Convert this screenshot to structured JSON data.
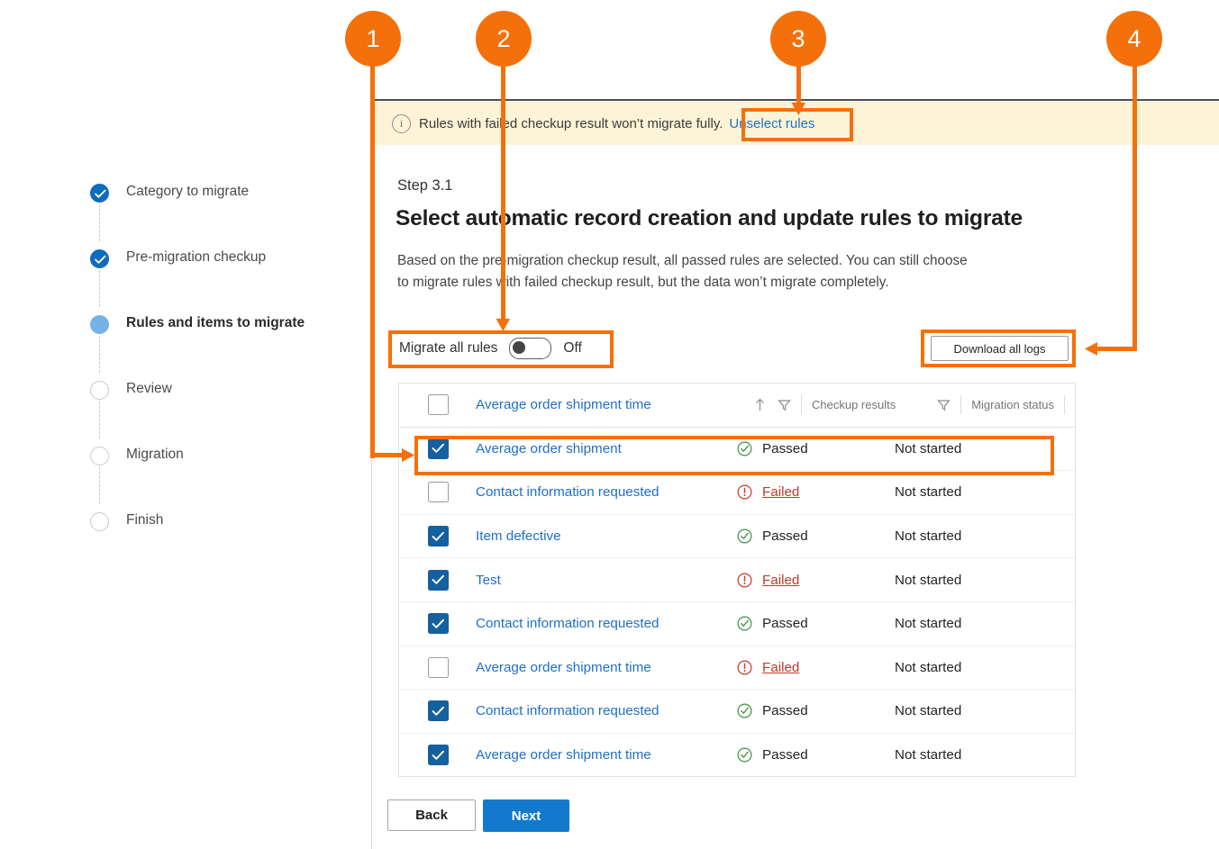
{
  "sidebar": {
    "steps": [
      {
        "label": "Category to migrate",
        "state": "done"
      },
      {
        "label": "Pre-migration checkup",
        "state": "done"
      },
      {
        "label": "Rules and items to migrate",
        "state": "current"
      },
      {
        "label": "Review",
        "state": "todo"
      },
      {
        "label": "Migration",
        "state": "todo"
      },
      {
        "label": "Finish",
        "state": "todo"
      }
    ]
  },
  "info_bar": {
    "icon": "info-circle-icon",
    "message": "Rules with failed checkup result won’t migrate fully.",
    "link_label": "Unselect rules"
  },
  "page": {
    "eyebrow": "Step 3.1",
    "title": "Select automatic record creation and update rules to migrate",
    "description": "Based on the pre-migration checkup result, all passed rules are selected. You can still choose to migrate rules with failed checkup result, but the data won’t migrate completely."
  },
  "controls": {
    "toggle_label": "Migrate all rules",
    "toggle_state": "Off",
    "toggle_on": false,
    "download_logs_label": "Download all logs"
  },
  "table": {
    "header": {
      "name": "Average order shipment time",
      "sort_icon": "sort-ascending-icon",
      "name_filter_icon": "filter-icon",
      "checkup_results": "Checkup results",
      "checkup_filter_icon": "filter-icon",
      "migration_status": "Migration status"
    },
    "rows": [
      {
        "checked": true,
        "name": "Average order shipment",
        "result": "Passed",
        "result_state": "passed",
        "status": "Not started"
      },
      {
        "checked": false,
        "name": "Contact information requested",
        "result": "Failed",
        "result_state": "failed",
        "status": "Not started"
      },
      {
        "checked": true,
        "name": "Item defective",
        "result": "Passed",
        "result_state": "passed",
        "status": "Not started"
      },
      {
        "checked": true,
        "name": "Test",
        "result": "Failed",
        "result_state": "failed",
        "status": "Not started"
      },
      {
        "checked": true,
        "name": "Contact information requested",
        "result": "Passed",
        "result_state": "passed",
        "status": "Not started"
      },
      {
        "checked": false,
        "name": "Average order shipment time",
        "result": "Failed",
        "result_state": "failed",
        "status": "Not started"
      },
      {
        "checked": true,
        "name": "Contact information requested",
        "result": "Passed",
        "result_state": "passed",
        "status": "Not started"
      },
      {
        "checked": true,
        "name": "Average order shipment time",
        "result": "Passed",
        "result_state": "passed",
        "status": "Not started"
      }
    ]
  },
  "footer": {
    "back_label": "Back",
    "next_label": "Next"
  },
  "callouts": {
    "accent_color": "#f4700a",
    "markers": [
      {
        "number": "1",
        "target": "selected-rule-row"
      },
      {
        "number": "2",
        "target": "migrate-all-rules-toggle"
      },
      {
        "number": "3",
        "target": "unselect-rules-link"
      },
      {
        "number": "4",
        "target": "download-all-logs-button"
      }
    ]
  },
  "colors": {
    "accent": "#f4700a",
    "link": "#1f6fc4",
    "primary_button": "#1279cd",
    "passed": "#3f8f43",
    "failed": "#c0392b",
    "info_bar_bg": "#fdf3d7"
  }
}
